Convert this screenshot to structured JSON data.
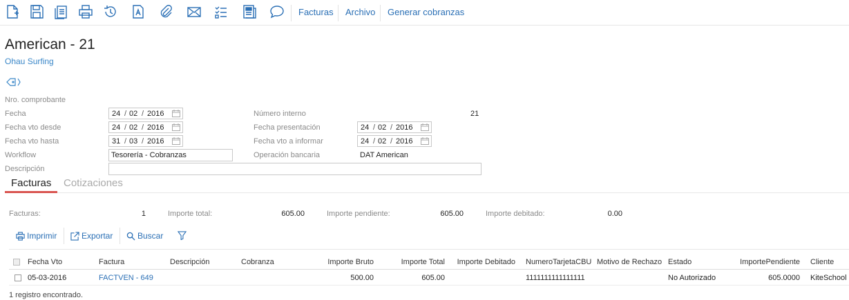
{
  "toolbar": {
    "icons": [
      "new-document-icon",
      "save-icon",
      "copy-icon",
      "print-icon",
      "history-icon",
      "text-document-icon",
      "attachment-icon",
      "mail-icon",
      "checklist-icon",
      "report-icon",
      "comment-icon"
    ],
    "links": [
      "Facturas",
      "Archivo",
      "Generar cobranzas"
    ]
  },
  "header": {
    "title": "American - 21",
    "subtitle": "Ohau Surfing"
  },
  "form": {
    "nro_comprobante_label": "Nro. comprobante",
    "fecha_label": "Fecha",
    "fecha": {
      "d": "24",
      "m": "02",
      "y": "2016"
    },
    "fecha_vto_desde_label": "Fecha vto desde",
    "fecha_vto_desde": {
      "d": "24",
      "m": "02",
      "y": "2016"
    },
    "fecha_vto_hasta_label": "Fecha vto hasta",
    "fecha_vto_hasta": {
      "d": "31",
      "m": "03",
      "y": "2016"
    },
    "workflow_label": "Workflow",
    "workflow": "Tesorería - Cobranzas",
    "descripcion_label": "Descripción",
    "descripcion": "",
    "numero_interno_label": "Número interno",
    "numero_interno": "21",
    "fecha_presentacion_label": "Fecha presentación",
    "fecha_presentacion": {
      "d": "24",
      "m": "02",
      "y": "2016"
    },
    "fecha_vto_informar_label": "Fecha vto a informar",
    "fecha_vto_informar": {
      "d": "24",
      "m": "02",
      "y": "2016"
    },
    "operacion_bancaria_label": "Operación bancaria",
    "operacion_bancaria": "DAT American"
  },
  "tabs": [
    {
      "label": "Facturas",
      "active": true
    },
    {
      "label": "Cotizaciones",
      "active": false
    }
  ],
  "summary": {
    "facturas_label": "Facturas:",
    "facturas": "1",
    "importe_total_label": "Importe total:",
    "importe_total": "605.00",
    "importe_pendiente_label": "Importe pendiente:",
    "importe_pendiente": "605.00",
    "importe_debitado_label": "Importe debitado:",
    "importe_debitado": "0.00"
  },
  "actions": {
    "imprimir": "Imprimir",
    "exportar": "Exportar",
    "buscar": "Buscar"
  },
  "grid": {
    "columns": [
      "Fecha Vto",
      "Factura",
      "Descripción",
      "Cobranza",
      "Importe Bruto",
      "Importe Total",
      "Importe Debitado",
      "NumeroTarjetaCBU",
      "Motivo de Rechazo",
      "Estado",
      "ImportePendiente",
      "Cliente"
    ],
    "rows": [
      [
        "05-03-2016",
        "FACTVEN - 649",
        "",
        "",
        "500.00",
        "605.00",
        "",
        "1111111111111111",
        "",
        "No Autorizado",
        "605.0000",
        "KiteSchool"
      ]
    ],
    "footer": "1 registro encontrado."
  },
  "colors": {
    "accent": "#2a6fb5",
    "tab_underline": "#d9534f"
  }
}
